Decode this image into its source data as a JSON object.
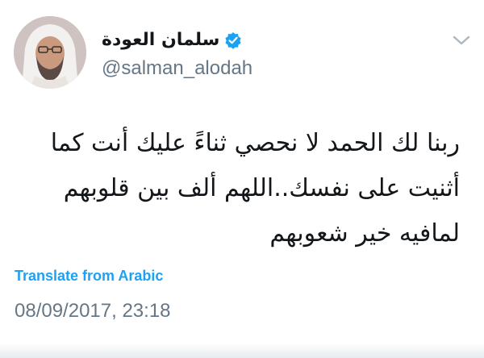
{
  "tweet": {
    "display_name": "سلمان العودة",
    "handle": "@salman_alodah",
    "verified": true,
    "text_lines": [
      "ربنا لك الحمد لا نحصي ثناءً عليك أنت كما",
      "أثنيت على نفسك..اللهم ألف بين قلوبهم",
      "لمافيه خير شعوبهم"
    ],
    "translate_label": "Translate from Arabic",
    "timestamp": "08/09/2017, 23:18"
  },
  "icons": {
    "verified": "verified-badge-icon",
    "menu": "chevron-down-icon"
  },
  "colors": {
    "accent": "#1da1f2",
    "text": "#14171a",
    "secondary": "#657786"
  }
}
